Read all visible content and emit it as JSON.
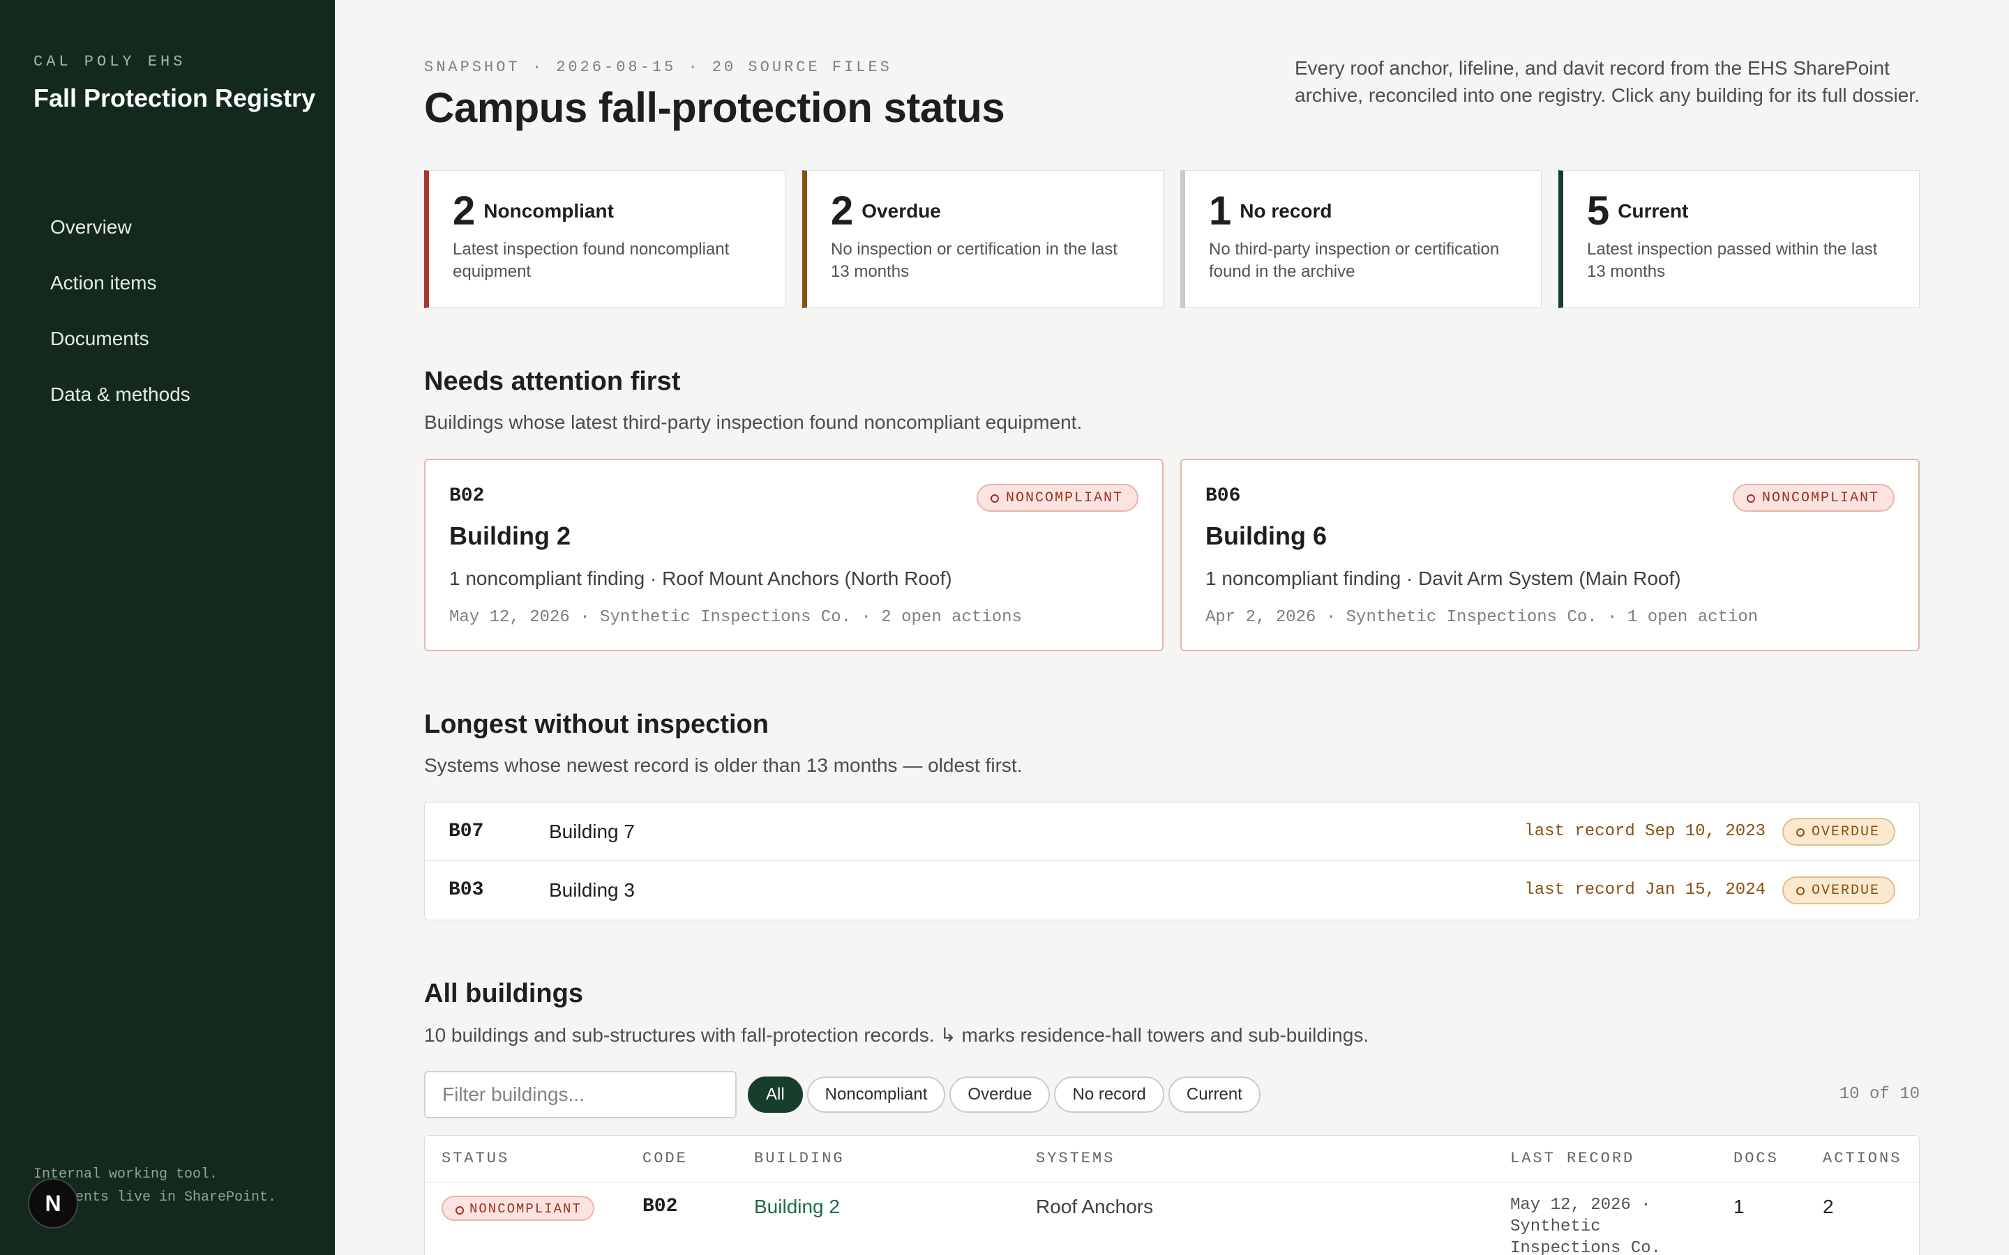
{
  "sidebar": {
    "kicker": "CAL POLY EHS",
    "brand": "Fall Protection Registry",
    "nav": [
      {
        "label": "Overview"
      },
      {
        "label": "Action items"
      },
      {
        "label": "Documents"
      },
      {
        "label": "Data & methods"
      }
    ],
    "footer_line1": "Internal working tool.",
    "footer_line2": "Documents live in SharePoint.",
    "badge": "N"
  },
  "header": {
    "snapshot": "SNAPSHOT · 2026-08-15 · 20 SOURCE FILES",
    "title": "Campus fall-protection status",
    "intro": "Every roof anchor, lifeline, and davit record from the EHS SharePoint archive, reconciled into one registry. Click any building for its full dossier."
  },
  "stats": [
    {
      "num": "2",
      "label": "Noncompliant",
      "desc": "Latest inspection found noncompliant equipment",
      "color": "#a33a2c"
    },
    {
      "num": "2",
      "label": "Overdue",
      "desc": "No inspection or certification in the last 13 months",
      "color": "#8a5010"
    },
    {
      "num": "1",
      "label": "No record",
      "desc": "No third-party inspection or certification found in the archive",
      "color": "#c5cbc6"
    },
    {
      "num": "5",
      "label": "Current",
      "desc": "Latest inspection passed within the last 13 months",
      "color": "#173d2b"
    }
  ],
  "attention": {
    "title": "Needs attention first",
    "subtitle": "Buildings whose latest third-party inspection found noncompliant equipment.",
    "cards": [
      {
        "code": "B02",
        "badge": "NONCOMPLIANT",
        "name": "Building 2",
        "finding": "1 noncompliant finding · Roof Mount Anchors (North Roof)",
        "meta": "May 12, 2026 · Synthetic Inspections Co. · 2 open actions"
      },
      {
        "code": "B06",
        "badge": "NONCOMPLIANT",
        "name": "Building 6",
        "finding": "1 noncompliant finding · Davit Arm System (Main Roof)",
        "meta": "Apr 2, 2026 · Synthetic Inspections Co. · 1 open action"
      }
    ]
  },
  "longest": {
    "title": "Longest without inspection",
    "subtitle": "Systems whose newest record is older than 13 months — oldest first.",
    "rows": [
      {
        "code": "B07",
        "name": "Building 7",
        "last": "last record Sep 10, 2023",
        "badge": "OVERDUE"
      },
      {
        "code": "B03",
        "name": "Building 3",
        "last": "last record Jan 15, 2024",
        "badge": "OVERDUE"
      }
    ]
  },
  "all": {
    "title": "All buildings",
    "subtitle": "10 buildings and sub-structures with fall-protection records. ↳ marks residence-hall towers and sub-buildings.",
    "filter_placeholder": "Filter buildings...",
    "chips": [
      "All",
      "Noncompliant",
      "Overdue",
      "No record",
      "Current"
    ],
    "count": "10 of 10",
    "columns": [
      "STATUS",
      "CODE",
      "BUILDING",
      "SYSTEMS",
      "LAST RECORD",
      "DOCS",
      "ACTIONS"
    ],
    "rows": [
      {
        "status": "NONCOMPLIANT",
        "code": "B02",
        "building": "Building 2",
        "systems": "Roof Anchors",
        "last_record": "May 12, 2026 · Synthetic Inspections Co.",
        "docs": "1",
        "actions": "2"
      }
    ]
  }
}
